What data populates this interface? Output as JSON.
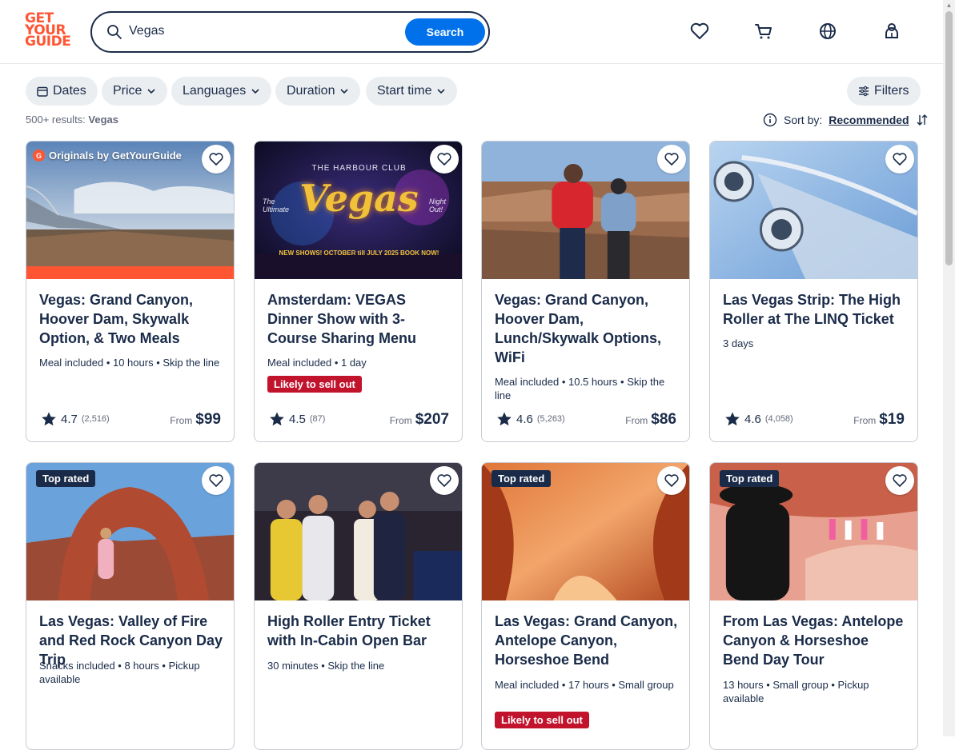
{
  "logo": {
    "line1": "GET",
    "line2": "YOUR",
    "line3": "GUIDE"
  },
  "search": {
    "value": "Vegas",
    "button_label": "Search"
  },
  "filters": [
    "Dates",
    "Price",
    "Languages",
    "Duration",
    "Start time"
  ],
  "filters_button": "Filters",
  "results": {
    "count": "500+ results:",
    "query": "Vegas"
  },
  "sort": {
    "label": "Sort by:",
    "value": "Recommended"
  },
  "colors": {
    "brand": "#ff5533",
    "primary": "#0071eb",
    "text": "#1a2b49",
    "sellout": "#c2132d",
    "badge": "#1a2b49"
  },
  "cards": [
    {
      "title": "Vegas: Grand Canyon, Hoover Dam, Skywalk Option, & Two Meals",
      "meta": "Meal included • 10 hours • Skip the line",
      "rating": "4.7",
      "reviews": "(2,516)",
      "from": "From",
      "price": "$99",
      "originals": "Originals by GetYourGuide",
      "originals_mark": "G"
    },
    {
      "title": "Amsterdam: VEGAS Dinner Show with 3-Course Sharing Menu",
      "meta": "Meal included • 1 day",
      "rating": "4.5",
      "reviews": "(87)",
      "from": "From",
      "price": "$207",
      "sellout": "Likely to sell out",
      "image_text": {
        "club": "THE HARBOUR CLUB",
        "big": "Vegas",
        "left": "The Ultimate",
        "right": "Night Out!",
        "bottom": "NEW SHOWS! OCTOBER till JULY 2025 BOOK NOW!"
      }
    },
    {
      "title": "Vegas: Grand Canyon, Hoover Dam, Lunch/Skywalk Options, WiFi",
      "meta": "Meal included • 10.5 hours • Skip the line",
      "rating": "4.6",
      "reviews": "(5,263)",
      "from": "From",
      "price": "$86"
    },
    {
      "title": "Las Vegas Strip: The High Roller at The LINQ Ticket",
      "meta": "3 days",
      "rating": "4.6",
      "reviews": "(4,058)",
      "from": "From",
      "price": "$19"
    },
    {
      "title": "Las Vegas: Valley of Fire and Red Rock Canyon Day Trip",
      "meta": "Snacks included • 8 hours • Pickup available",
      "badge": "Top rated"
    },
    {
      "title": "High Roller Entry Ticket with In-Cabin Open Bar",
      "meta": "30 minutes • Skip the line"
    },
    {
      "title": "Las Vegas: Grand Canyon, Antelope Canyon, Horseshoe Bend",
      "meta": "Meal included • 17 hours • Small group",
      "badge": "Top rated",
      "sellout": "Likely to sell out"
    },
    {
      "title": "From Las Vegas: Antelope Canyon & Horseshoe Bend Day Tour",
      "meta": "13 hours • Small group • Pickup available",
      "badge": "Top rated"
    }
  ]
}
